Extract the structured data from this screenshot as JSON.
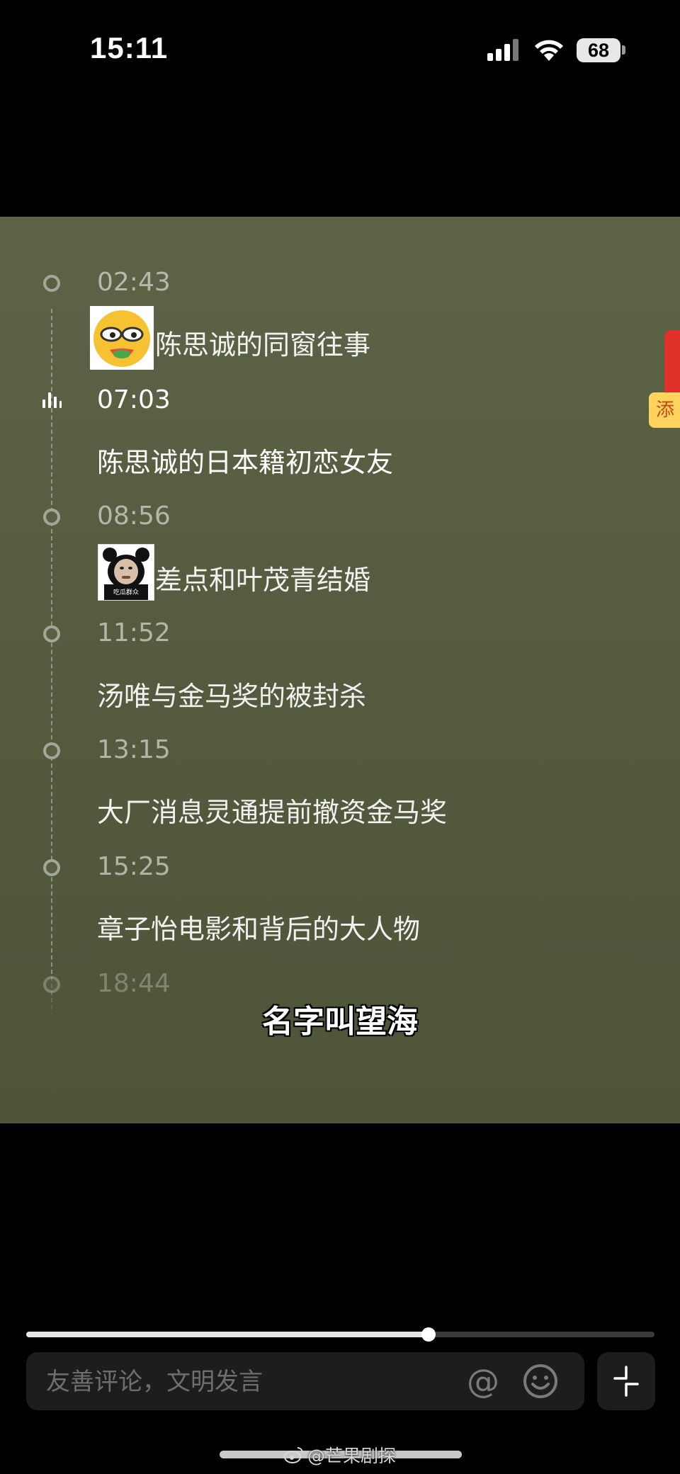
{
  "status_bar": {
    "time": "15:11",
    "battery": "68"
  },
  "timeline": {
    "items": [
      {
        "time": "02:43",
        "title": "陈思诚的同窗往事",
        "sticker": "smiling-emoji-sticker",
        "active": false
      },
      {
        "time": "07:03",
        "title": "陈思诚的日本籍初恋女友",
        "active": true
      },
      {
        "time": "08:56",
        "title": "差点和叶茂青结婚",
        "sticker": "panda-meme-sticker",
        "active": false
      },
      {
        "time": "11:52",
        "title": "汤唯与金马奖的被封杀",
        "active": false
      },
      {
        "time": "13:15",
        "title": "大厂消息灵通提前撤资金马奖",
        "active": false
      },
      {
        "time": "15:25",
        "title": "章子怡电影和背后的大人物",
        "active": false
      },
      {
        "time": "18:44",
        "title": "",
        "active": false
      }
    ]
  },
  "subtitle": "名字叫望海",
  "side_badge": "添加",
  "panda_caption": "吃瓜群众",
  "progress": {
    "fraction": 0.64
  },
  "comment": {
    "placeholder": "友善评论，文明发言",
    "at_symbol": "@"
  },
  "watermark": "@芒果剧探",
  "colors": {
    "video_bg": "#5a6043",
    "red_packet": "#e0302a",
    "badge_yellow": "#ffd35c"
  }
}
